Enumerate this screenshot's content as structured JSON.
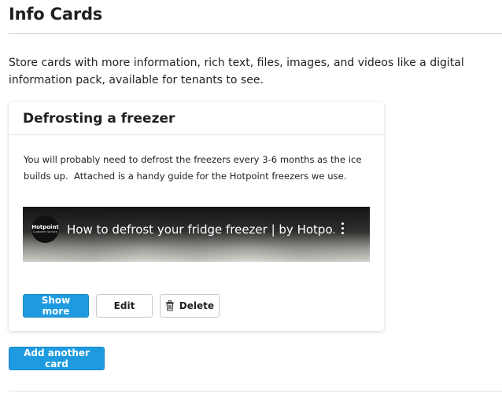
{
  "page": {
    "title": "Info Cards",
    "intro": "Store cards with more information, rich text, files, images, and videos like a digital information pack, available for tenants to see."
  },
  "card": {
    "title": "Defrosting a freezer",
    "body": "You will probably need to defrost the freezers every 3-6 months as the ice builds up.  Attached is a handy guide for the Hotpoint freezers we use.",
    "video": {
      "title": "How to defrost your fridge freezer | by Hotpo...",
      "channel_logo_line1": "Hotpoint",
      "channel_logo_line2": "Customer Service",
      "menu_icon": "kebab-menu-icon"
    },
    "buttons": {
      "show_more": "Show more",
      "edit": "Edit",
      "delete": "Delete",
      "delete_icon": "trash-icon"
    }
  },
  "add_card_label": "Add another card",
  "colors": {
    "primary_button": "#1e9be0",
    "text": "#1f1f1f",
    "divider": "#d7d7d7"
  }
}
